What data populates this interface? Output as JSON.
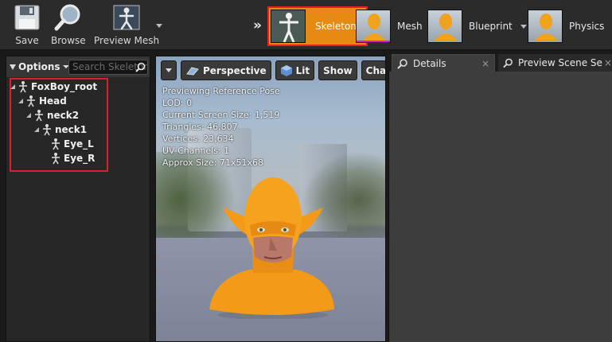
{
  "toolbar": {
    "buttons": [
      {
        "label": "Save",
        "icon": "floppy-disk-icon"
      },
      {
        "label": "Browse",
        "icon": "magnifier-icon"
      },
      {
        "label": "Preview Mesh",
        "icon": "figure-preview-icon"
      }
    ],
    "modes": [
      {
        "label": "Skeleton",
        "active": true
      },
      {
        "label": "Mesh",
        "active": false
      },
      {
        "label": "Blueprint",
        "active": false
      },
      {
        "label": "Physics",
        "active": false
      }
    ],
    "mode_arrows": "»",
    "colors": {
      "active_mode": "#e78a14",
      "highlight_border": "#e01d2a"
    }
  },
  "skeleton_tree": {
    "options_label": "Options",
    "search_placeholder": "Search Skeleton",
    "bones": [
      {
        "name": "FoxBoy_root",
        "depth": 0,
        "expanded": true
      },
      {
        "name": "Head",
        "depth": 1,
        "expanded": true
      },
      {
        "name": "neck2",
        "depth": 2,
        "expanded": true
      },
      {
        "name": "neck1",
        "depth": 3,
        "expanded": true
      },
      {
        "name": "Eye_L",
        "depth": 4,
        "expanded": false
      },
      {
        "name": "Eye_R",
        "depth": 4,
        "expanded": false
      }
    ]
  },
  "viewport": {
    "toolbar": {
      "perspective": "Perspective",
      "lit": "Lit",
      "show": "Show",
      "character": "Character"
    },
    "stats": [
      "Previewing Reference Pose",
      "LOD: 0",
      "Current Screen Size: 1,519",
      "Triangles: 46,807",
      "Vertices: 23,634",
      "UV Channels: 1",
      "Approx Size: 71x51x68"
    ]
  },
  "panels": {
    "tabs": [
      {
        "label": "Details",
        "active": true,
        "close": "×"
      },
      {
        "label": "Preview Scene Se",
        "active": false,
        "close": "×"
      }
    ]
  }
}
